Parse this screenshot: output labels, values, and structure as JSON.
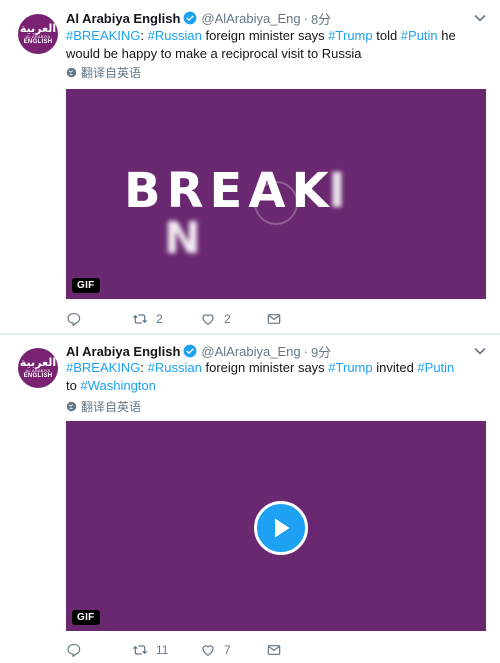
{
  "colors": {
    "accent": "#1da1f2",
    "media_bg": "#6a2870",
    "avatar_bg": "#7a2272",
    "verified": "#1da1f2"
  },
  "tweets": [
    {
      "author": {
        "name": "Al Arabiya English",
        "handle": "@AlArabiya_Eng",
        "avatar_arabic": "العربية",
        "avatar_line": "AL ARABIYA",
        "avatar_english": "ENGLISH"
      },
      "separator": "·",
      "time": "8分",
      "text": {
        "t1": "#BREAKING",
        "t2": ": ",
        "t3": "#Russian",
        "t4": " foreign minister says ",
        "t5": "#Trump",
        "t6": " told ",
        "t7": "#Putin",
        "t8": " he would be happy to make a reciprocal visit to Russia"
      },
      "translate_label": "翻译自英语",
      "media": {
        "type": "gif",
        "badge": "GIF",
        "frame_text_main": "BREAK",
        "frame_text_i": "I",
        "frame_text_n": "N"
      },
      "actions": {
        "reply_count": "",
        "retweet_count": "2",
        "like_count": "2"
      }
    },
    {
      "author": {
        "name": "Al Arabiya English",
        "handle": "@AlArabiya_Eng",
        "avatar_arabic": "العربية",
        "avatar_line": "AL ARABIYA",
        "avatar_english": "ENGLISH"
      },
      "separator": "·",
      "time": "9分",
      "text": {
        "t1": "#BREAKING",
        "t2": ": ",
        "t3": "#Russian",
        "t4": " foreign minister says ",
        "t5": "#Trump",
        "t6": " invited ",
        "t7": "#Putin",
        "t8": " to ",
        "t9": "#Washington"
      },
      "translate_label": "翻译自英语",
      "media": {
        "type": "gif",
        "badge": "GIF"
      },
      "actions": {
        "reply_count": "",
        "retweet_count": "11",
        "like_count": "7"
      }
    }
  ]
}
